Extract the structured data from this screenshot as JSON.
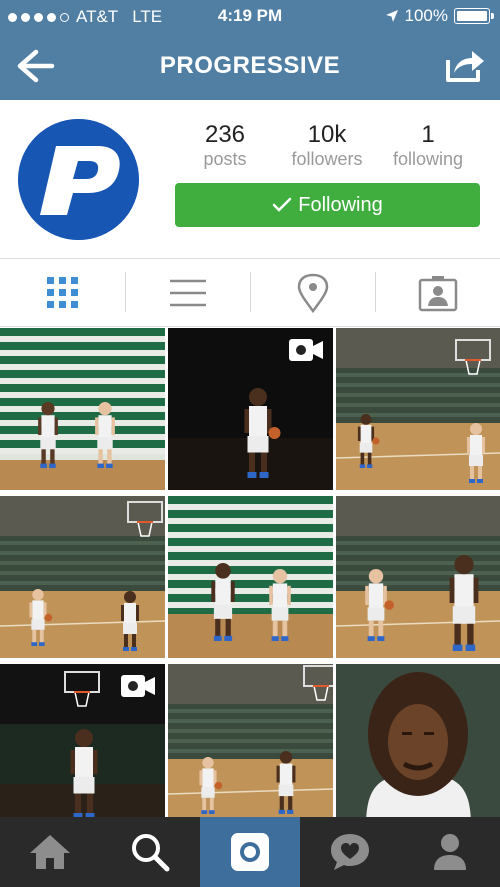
{
  "status_bar": {
    "carrier": "AT&T",
    "network": "LTE",
    "time": "4:19 PM",
    "battery": "100%",
    "battery_level": 1.0,
    "signal_bars_filled": 4,
    "signal_bars_total": 5
  },
  "nav": {
    "title": "PROGRESSIVE",
    "back_icon": "arrow-left-icon",
    "share_icon": "share-icon"
  },
  "profile": {
    "avatar_letter": "P",
    "stats": [
      {
        "value": "236",
        "label": "posts"
      },
      {
        "value": "10k",
        "label": "followers"
      },
      {
        "value": "1",
        "label": "following"
      }
    ],
    "follow_button": {
      "label": "Following",
      "icon": "checkmark-icon"
    }
  },
  "view_tabs": [
    {
      "icon": "grid-icon",
      "active": true
    },
    {
      "icon": "list-icon",
      "active": false
    },
    {
      "icon": "location-pin-icon",
      "active": false
    },
    {
      "icon": "tagged-photos-icon",
      "active": false
    }
  ],
  "grid": {
    "photos": [
      {
        "kind": "bleachers",
        "is_video": false
      },
      {
        "kind": "dark-solo",
        "is_video": true
      },
      {
        "kind": "court-duo",
        "is_video": false
      },
      {
        "kind": "court-duo-alt",
        "is_video": false
      },
      {
        "kind": "bleachers-sitting",
        "is_video": false
      },
      {
        "kind": "court-duo-close",
        "is_video": false
      },
      {
        "kind": "dark-solo-hoop",
        "is_video": true
      },
      {
        "kind": "court-duo-far",
        "is_video": false
      },
      {
        "kind": "portrait",
        "is_video": false
      }
    ]
  },
  "tab_bar": [
    {
      "icon": "home-icon",
      "active": false
    },
    {
      "icon": "search-icon",
      "active": false
    },
    {
      "icon": "camera-icon",
      "active": true
    },
    {
      "icon": "activity-icon",
      "active": false
    },
    {
      "icon": "profile-icon",
      "active": false
    }
  ],
  "colors": {
    "header_blue": "#517fa4",
    "follow_green": "#3fae3f",
    "tab_active": "#3e6f9c",
    "tab_bar": "#2a2a2a",
    "grid_icon_blue": "#3f8ed3",
    "brand_blue": "#1856b4"
  }
}
